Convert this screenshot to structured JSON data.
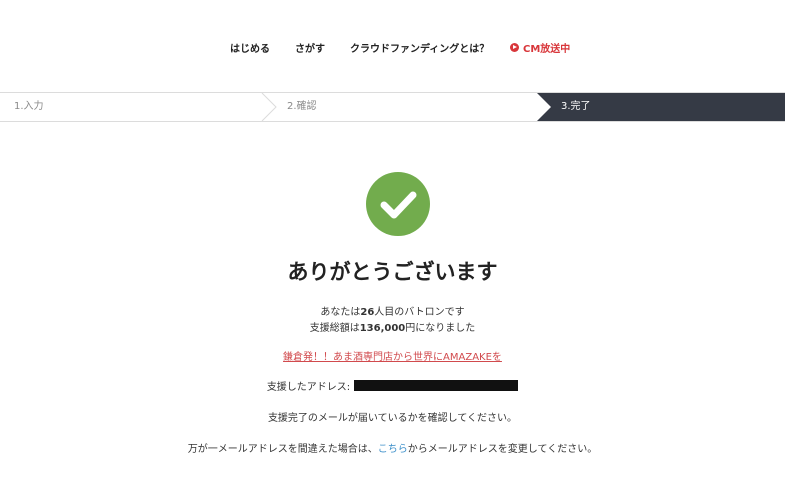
{
  "nav": {
    "items": [
      "はじめる",
      "さがす",
      "クラウドファンディングとは？"
    ],
    "cm_label": "CM放送中"
  },
  "steps": {
    "items": [
      {
        "label": "1.入力",
        "active": false
      },
      {
        "label": "2.確認",
        "active": false
      },
      {
        "label": "3.完了",
        "active": true
      }
    ]
  },
  "main": {
    "headline": "ありがとうございます",
    "baton_prefix": "あなたは",
    "baton_count": "26",
    "baton_suffix": "人目のバトロンです",
    "amount_prefix": "支援総額は",
    "amount_value": "136,000",
    "amount_suffix": "円になりました",
    "project_link": "鎌倉発！！あま酒専門店から世界にAMAZAKEを",
    "address_label": "支援したアドレス:",
    "mail_notice": "支援完了のメールが届いているかを確認してください。",
    "change_prefix": "万が一メールアドレスを間違えた場合は、",
    "change_link": "こちら",
    "change_suffix": "からメールアドレスを変更してください。"
  },
  "colors": {
    "accent_red": "#d8363a",
    "check_green": "#72ac4d",
    "active_step_bg": "#353a45",
    "link_blue": "#3c8fc9"
  },
  "icons": {
    "cm": "play-circle-icon",
    "success": "check-circle-icon"
  }
}
